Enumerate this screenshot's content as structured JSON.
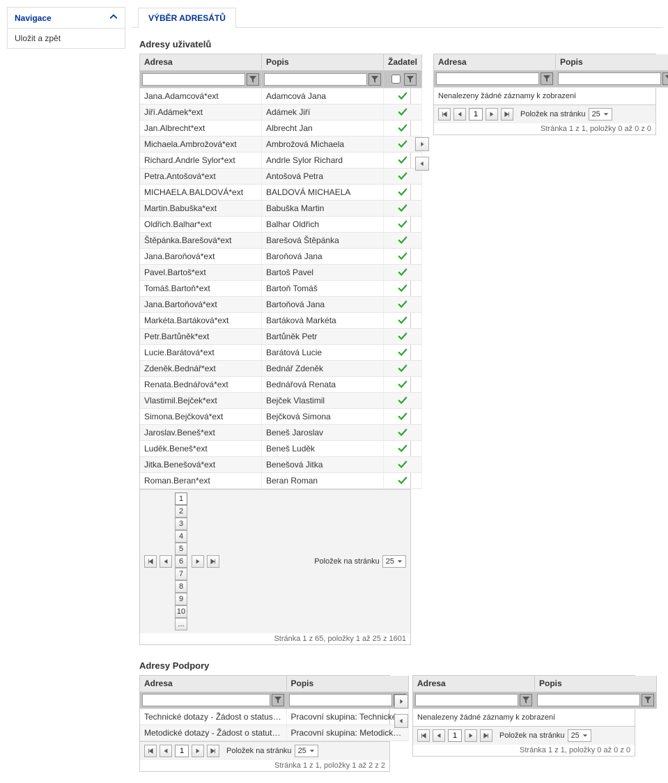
{
  "sidebar": {
    "nav_title": "Navigace",
    "items": [
      "Uložit a zpět"
    ]
  },
  "tab": {
    "label": "VÝBĚR ADRESÁTŮ"
  },
  "section_users": {
    "title": "Adresy uživatelů",
    "left": {
      "cols": {
        "adresa": "Adresa",
        "popis": "Popis",
        "zadatel": "Žadatel"
      },
      "rows": [
        {
          "adresa": "Jana.Adamcová*ext",
          "popis": "Adamcová Jana"
        },
        {
          "adresa": "Jiří.Adámek*ext",
          "popis": "Adámek Jiří"
        },
        {
          "adresa": "Jan.Albrecht*ext",
          "popis": "Albrecht Jan"
        },
        {
          "adresa": "Michaela.Ambrožová*ext",
          "popis": "Ambrožová Michaela"
        },
        {
          "adresa": "Richard.Andrle Sylor*ext",
          "popis": "Andrle Sylor Richard"
        },
        {
          "adresa": "Petra.Antošová*ext",
          "popis": "Antošová Petra"
        },
        {
          "adresa": "MICHAELA.BALDOVÁ*ext",
          "popis": "BALDOVÁ MICHAELA"
        },
        {
          "adresa": "Martin.Babuška*ext",
          "popis": "Babuška Martin"
        },
        {
          "adresa": "Oldřich.Balhar*ext",
          "popis": "Balhar Oldřich"
        },
        {
          "adresa": "Štěpánka.Barešová*ext",
          "popis": "Barešová Štěpánka"
        },
        {
          "adresa": "Jana.Baroňová*ext",
          "popis": "Baroňová Jana"
        },
        {
          "adresa": "Pavel.Bartoš*ext",
          "popis": "Bartoš Pavel"
        },
        {
          "adresa": "Tomáš.Bartoň*ext",
          "popis": "Bartoň Tomáš"
        },
        {
          "adresa": "Jana.Bartoňová*ext",
          "popis": "Bartoňová Jana"
        },
        {
          "adresa": "Markéta.Bartáková*ext",
          "popis": "Bartáková Markéta"
        },
        {
          "adresa": "Petr.Bartůněk*ext",
          "popis": "Bartůněk Petr"
        },
        {
          "adresa": "Lucie.Barátová*ext",
          "popis": "Barátová Lucie"
        },
        {
          "adresa": "Zdeněk.Bednář*ext",
          "popis": "Bednář Zdeněk"
        },
        {
          "adresa": "Renata.Bednářová*ext",
          "popis": "Bednářová Renata"
        },
        {
          "adresa": "Vlastimil.Bejček*ext",
          "popis": "Bejček Vlastimil"
        },
        {
          "adresa": "Simona.Bejčková*ext",
          "popis": "Bejčková Simona"
        },
        {
          "adresa": "Jaroslav.Beneš*ext",
          "popis": "Beneš Jaroslav"
        },
        {
          "adresa": "Luděk.Beneš*ext",
          "popis": "Beneš Luděk"
        },
        {
          "adresa": "Jitka.Benešová*ext",
          "popis": "Benešová Jitka"
        },
        {
          "adresa": "Roman.Beran*ext",
          "popis": "Beran Roman"
        }
      ],
      "pager": {
        "current": "1",
        "pages": [
          "1",
          "2",
          "3",
          "4",
          "5",
          "6",
          "7",
          "8",
          "9",
          "10",
          "..."
        ],
        "size_label": "Položek na stránku",
        "size_value": "25",
        "info": "Stránka 1 z 65, položky 1 až 25 z 1601"
      }
    },
    "right": {
      "cols": {
        "adresa": "Adresa",
        "popis": "Popis"
      },
      "empty": "Nenalezeny žádné záznamy k zobrazení",
      "pager": {
        "page_input": "1",
        "size_label": "Položek na stránku",
        "size_value": "25",
        "info": "Stránka 1 z 1, položky 0 až 0 z 0"
      }
    }
  },
  "section_support": {
    "title": "Adresy Podpory",
    "left": {
      "cols": {
        "adresa": "Adresa",
        "popis": "Popis"
      },
      "rows": [
        {
          "adresa": "Technické dotazy - Žádost o status hod...",
          "popis": "Pracovní skupina: Technické..."
        },
        {
          "adresa": "Metodické dotazy - Žádost o statuts ho...",
          "popis": "Pracovní skupina: Metodické..."
        }
      ],
      "pager": {
        "page_input": "1",
        "size_label": "Položek na stránku",
        "size_value": "25",
        "info": "Stránka 1 z 1, položky 1 až 2 z 2"
      }
    },
    "right": {
      "cols": {
        "adresa": "Adresa",
        "popis": "Popis"
      },
      "empty": "Nenalezeny žádné záznamy k zobrazení",
      "pager": {
        "page_input": "1",
        "size_label": "Položek na stránku",
        "size_value": "25",
        "info": "Stránka 1 z 1, položky 0 až 0 z 0"
      }
    }
  }
}
